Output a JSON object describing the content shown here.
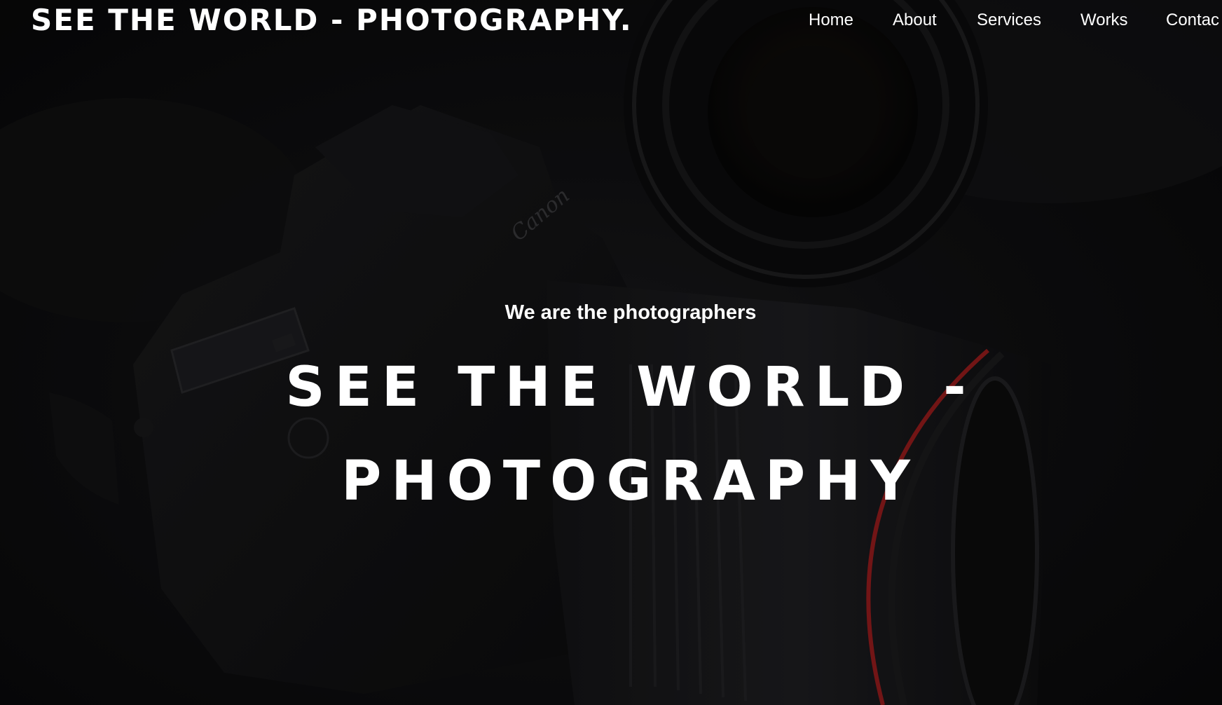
{
  "header": {
    "brand": "SEE THE WORLD - PHOTOGRAPHY."
  },
  "nav": {
    "items": [
      "Home",
      "About",
      "Services",
      "Works",
      "Contac"
    ]
  },
  "hero": {
    "tagline": "We are the photographers",
    "headline": "SEE THE WORLD - PHOTOGRAPHY",
    "background_image": "camera-photo",
    "camera_brand_text": "Canon"
  },
  "colors": {
    "text": "#ffffff",
    "background": "#0a0a0b",
    "accent_ring": "#b01e1e"
  }
}
